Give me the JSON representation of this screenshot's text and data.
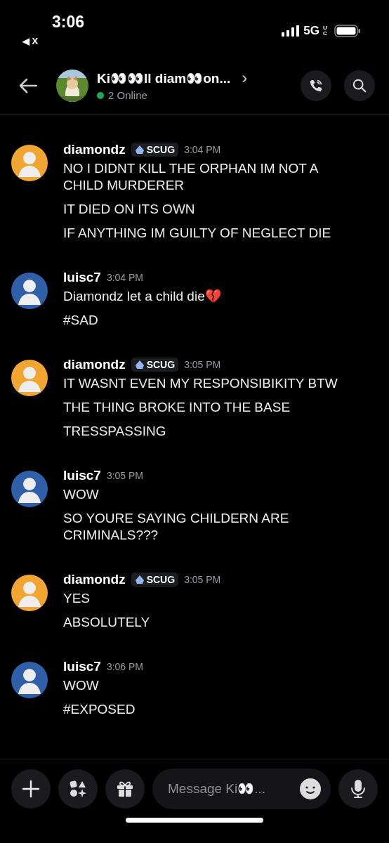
{
  "status_bar": {
    "time": "3:06",
    "back_app": "◀ X",
    "network": "5G",
    "network_sub": "UC"
  },
  "header": {
    "title": "Ki👀👀ll diam👀on...",
    "chevron": "›",
    "online": "2 Online"
  },
  "messages": [
    {
      "author": "diamondz",
      "badge": "SCUG",
      "time": "3:04 PM",
      "color": "#f2a531",
      "lines": [
        "NO I DIDNT KILL THE ORPHAN IM NOT A CHILD MURDERER",
        "IT DIED ON ITS OWN",
        "IF ANYTHING IM GUILTY OF NEGLECT DIE"
      ]
    },
    {
      "author": "luisc7",
      "time": "3:04 PM",
      "color": "#2e5fa8",
      "lines": [
        "Diamondz let a child die💔",
        "#SAD"
      ]
    },
    {
      "author": "diamondz",
      "badge": "SCUG",
      "time": "3:05 PM",
      "color": "#f2a531",
      "lines": [
        "IT WASNT EVEN MY RESPONSIBIKITY BTW",
        "THE THING BROKE INTO THE BASE",
        "TRESSPASSING"
      ]
    },
    {
      "author": "luisc7",
      "time": "3:05 PM",
      "color": "#2e5fa8",
      "lines": [
        "WOW",
        "SO YOURE SAYING CHILDERN ARE CRIMINALS???"
      ]
    },
    {
      "author": "diamondz",
      "badge": "SCUG",
      "time": "3:05 PM",
      "color": "#f2a531",
      "lines": [
        "YES",
        "ABSOLUTELY"
      ]
    },
    {
      "author": "luisc7",
      "time": "3:06 PM",
      "color": "#2e5fa8",
      "lines": [
        "WOW",
        "#EXPOSED"
      ]
    }
  ],
  "composer": {
    "placeholder": "Message Ki👀..."
  }
}
